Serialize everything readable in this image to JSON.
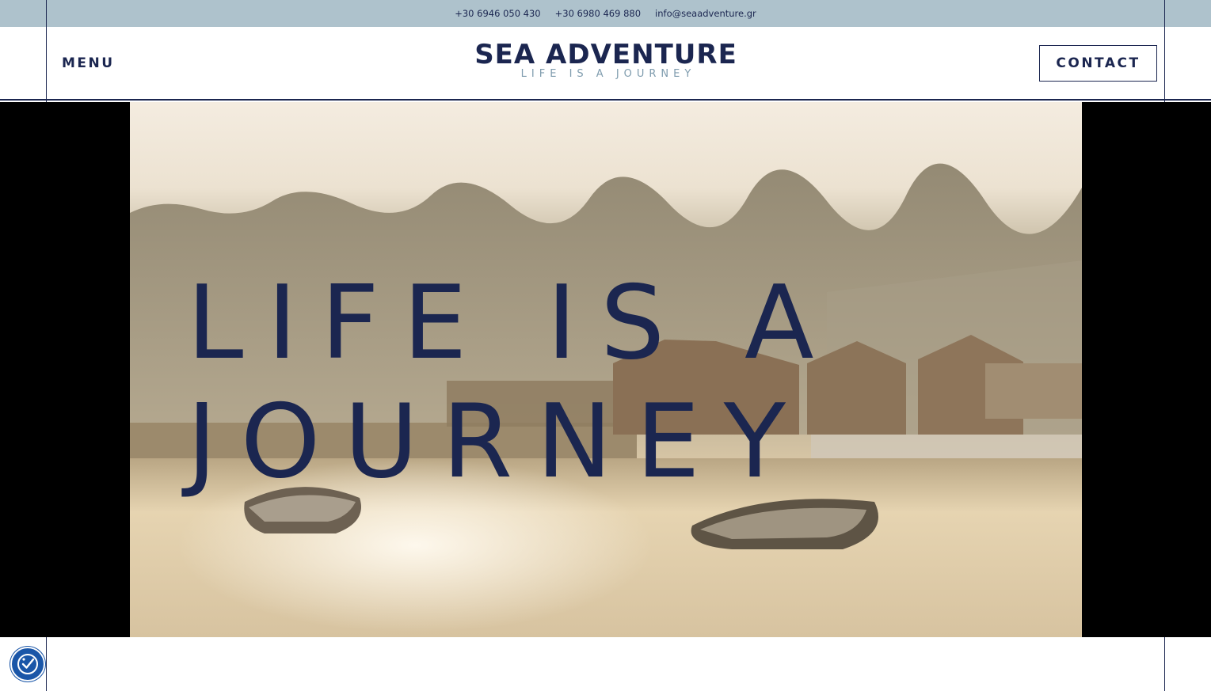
{
  "topbar": {
    "phone1": "+30 6946 050 430",
    "phone2": "+30 6980 469 880",
    "email": "info@seaadventure.gr"
  },
  "header": {
    "menu_label": "MENU",
    "brand_name": "SEA ADVENTURE",
    "brand_tagline": "LIFE IS A JOURNEY",
    "contact_label": "CONTACT"
  },
  "hero": {
    "headline_line1": "LIFE IS A",
    "headline_line2": "JOURNEY"
  },
  "accessibility": {
    "icon": "accessibility-icon"
  },
  "colors": {
    "navy": "#1b2650",
    "topbar_bg": "#aec2cc",
    "tagline": "#7f9cae",
    "accessibility_blue": "#1a56a8"
  }
}
